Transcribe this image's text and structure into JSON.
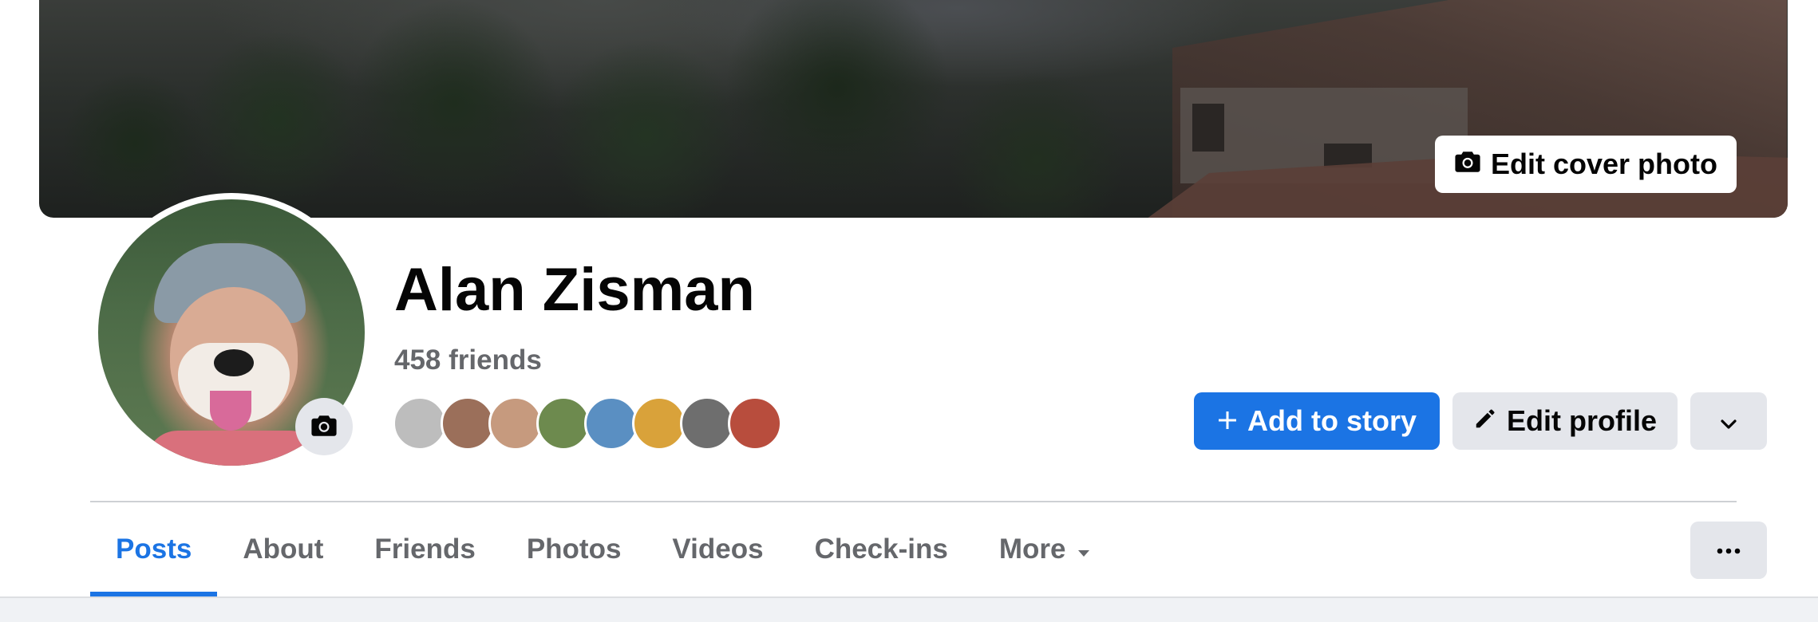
{
  "cover": {
    "edit_button_label": "Edit cover photo",
    "icon": "camera-icon"
  },
  "profile": {
    "name": "Alan Zisman",
    "friends_count": "458 friends",
    "avatar_camera_icon": "camera-icon"
  },
  "friend_avatars": [
    {
      "color": "#bdbdbd"
    },
    {
      "color": "#9b6f5a"
    },
    {
      "color": "#c69a7e"
    },
    {
      "color": "#6d8a4e"
    },
    {
      "color": "#5a8fc2"
    },
    {
      "color": "#d9a23a"
    },
    {
      "color": "#6e6e6e"
    },
    {
      "color": "#b84d3d"
    }
  ],
  "actions": {
    "add_story": {
      "label": "Add to story",
      "icon": "plus-icon"
    },
    "edit_profile": {
      "label": "Edit profile",
      "icon": "pencil-icon"
    },
    "more": {
      "icon": "chevron-down-icon"
    }
  },
  "tabs": [
    {
      "label": "Posts",
      "active": true
    },
    {
      "label": "About"
    },
    {
      "label": "Friends"
    },
    {
      "label": "Photos"
    },
    {
      "label": "Videos"
    },
    {
      "label": "Check-ins"
    },
    {
      "label": "More",
      "icon": "caret-down-icon"
    }
  ],
  "tab_overflow": {
    "icon": "ellipsis-icon"
  },
  "colors": {
    "accent": "#1b74e4",
    "secondary_button": "#e4e6eb",
    "secondary_text": "#65676b",
    "page_bg": "#f0f2f5"
  }
}
